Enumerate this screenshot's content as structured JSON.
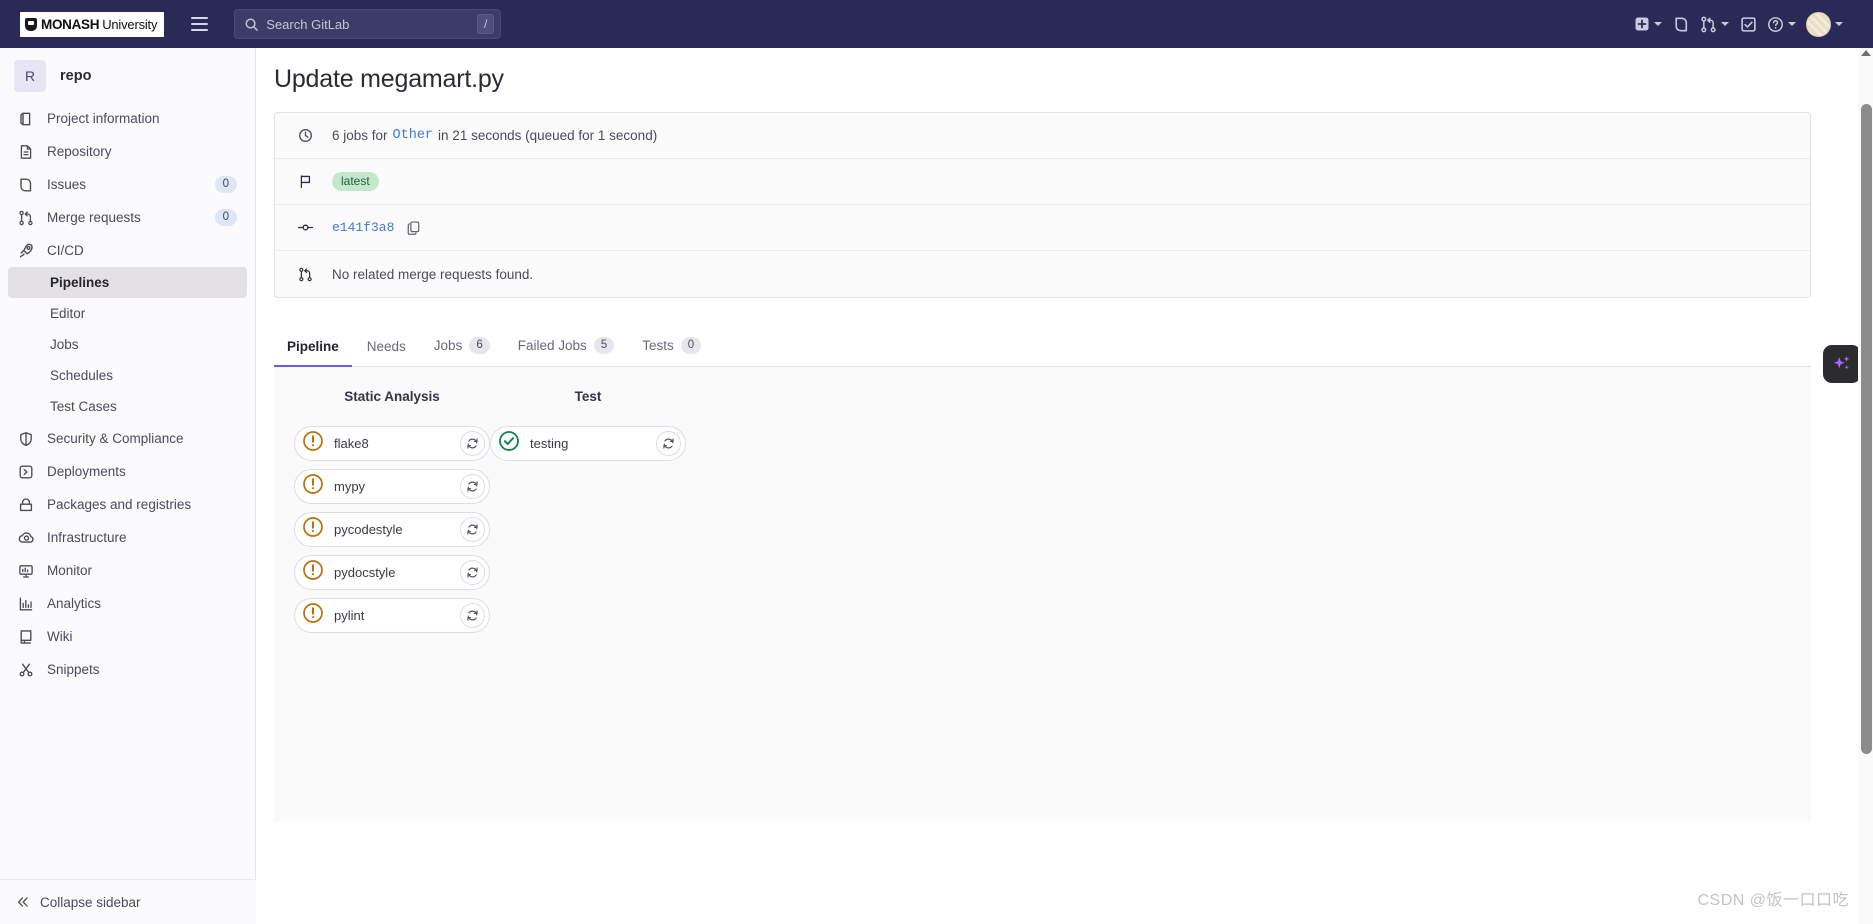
{
  "topnav": {
    "brand": {
      "name": "MONASH",
      "suffix": "University"
    },
    "hamburger_label": "menu-toggle",
    "search": {
      "placeholder": "Search GitLab",
      "value": "",
      "shortcut": "/"
    },
    "right_items": [
      {
        "name": "create-new-menu",
        "icon": "plus-square-icon",
        "chevron": true
      },
      {
        "name": "issues-link",
        "icon": "issues-icon",
        "chevron": false
      },
      {
        "name": "merge-requests-menu",
        "icon": "merge-request-icon",
        "chevron": true
      },
      {
        "name": "todos-link",
        "icon": "todo-check-icon",
        "chevron": false
      },
      {
        "name": "help-menu",
        "icon": "help-circle-icon",
        "chevron": true
      },
      {
        "name": "user-menu",
        "icon": "avatar",
        "chevron": true
      }
    ]
  },
  "sidebar": {
    "project": {
      "initial": "R",
      "name": "repo"
    },
    "items": [
      {
        "label": "Project information",
        "icon": "project-info-icon",
        "count": null
      },
      {
        "label": "Repository",
        "icon": "repository-icon",
        "count": null
      },
      {
        "label": "Issues",
        "icon": "issues-icon",
        "count": "0"
      },
      {
        "label": "Merge requests",
        "icon": "merge-request-icon",
        "count": "0"
      },
      {
        "label": "CI/CD",
        "icon": "rocket-icon",
        "count": null
      }
    ],
    "cicd_subitems": [
      {
        "label": "Pipelines",
        "active": true
      },
      {
        "label": "Editor",
        "active": false
      },
      {
        "label": "Jobs",
        "active": false
      },
      {
        "label": "Schedules",
        "active": false
      },
      {
        "label": "Test Cases",
        "active": false
      }
    ],
    "items_after": [
      {
        "label": "Security & Compliance",
        "icon": "shield-icon",
        "count": null
      },
      {
        "label": "Deployments",
        "icon": "deployments-icon",
        "count": null
      },
      {
        "label": "Packages and registries",
        "icon": "package-icon",
        "count": null
      },
      {
        "label": "Infrastructure",
        "icon": "infrastructure-cloud-icon",
        "count": null
      },
      {
        "label": "Monitor",
        "icon": "monitor-icon",
        "count": null
      },
      {
        "label": "Analytics",
        "icon": "analytics-chart-icon",
        "count": null
      },
      {
        "label": "Wiki",
        "icon": "wiki-book-icon",
        "count": null
      },
      {
        "label": "Snippets",
        "icon": "snippets-scissors-icon",
        "count": null
      }
    ],
    "collapse_label": "Collapse sidebar"
  },
  "main": {
    "page_title": "Update megamart.py",
    "info_rows": {
      "jobs_summary_prefix": "6 jobs for",
      "jobs_summary_ref": "Other",
      "jobs_summary_suffix": "in 21 seconds (queued for 1 second)",
      "latest_badge": "latest",
      "commit_sha": "e141f3a8",
      "merge_request_text": "No related merge requests found."
    },
    "tabs": [
      {
        "label": "Pipeline",
        "count": null,
        "active": true
      },
      {
        "label": "Needs",
        "count": null,
        "active": false
      },
      {
        "label": "Jobs",
        "count": "6",
        "active": false
      },
      {
        "label": "Failed Jobs",
        "count": "5",
        "active": false
      },
      {
        "label": "Tests",
        "count": "0",
        "active": false
      }
    ],
    "stages": [
      {
        "title": "Static Analysis",
        "jobs": [
          {
            "name": "flake8",
            "status": "failed"
          },
          {
            "name": "mypy",
            "status": "failed"
          },
          {
            "name": "pycodestyle",
            "status": "failed"
          },
          {
            "name": "pydocstyle",
            "status": "failed"
          },
          {
            "name": "pylint",
            "status": "failed"
          }
        ]
      },
      {
        "title": "Test",
        "jobs": [
          {
            "name": "testing",
            "status": "passed"
          }
        ]
      }
    ]
  },
  "ai_button": {
    "name": "ai-assistant-button",
    "icon": "sparkles-icon"
  },
  "watermark": {
    "text": "CSDN @饭一口口吃"
  },
  "colors": {
    "nav_bg": "#2b2a57",
    "accent_purple": "#6b5ce7",
    "failed_orange": "#b8710c",
    "passed_green": "#108548",
    "link_blue": "#3f7ad1",
    "badge_green_bg": "#c5e8cd"
  }
}
